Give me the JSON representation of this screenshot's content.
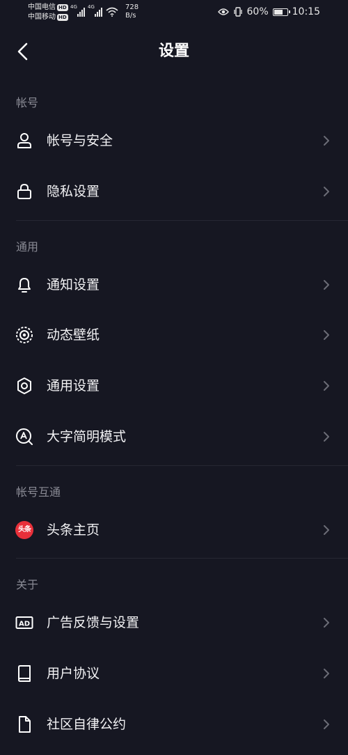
{
  "status_bar": {
    "carrier_1": "中国电信",
    "carrier_2": "中国移动",
    "hd_label": "HD",
    "net_type": "4G",
    "speed_value": "728",
    "speed_unit": "B/s",
    "battery": "60%",
    "time": "10:15"
  },
  "header": {
    "title": "设置",
    "back_icon": "chevron-left-icon"
  },
  "sections": {
    "account": {
      "title": "帐号",
      "items": [
        {
          "label": "帐号与安全",
          "icon": "user-icon"
        },
        {
          "label": "隐私设置",
          "icon": "lock-icon"
        }
      ]
    },
    "general": {
      "title": "通用",
      "items": [
        {
          "label": "通知设置",
          "icon": "bell-icon"
        },
        {
          "label": "动态壁纸",
          "icon": "live-wallpaper-icon"
        },
        {
          "label": "通用设置",
          "icon": "gear-icon"
        },
        {
          "label": "大字简明模式",
          "icon": "large-font-icon"
        }
      ]
    },
    "linked": {
      "title": "帐号互通",
      "items": [
        {
          "label": "头条主页",
          "icon": "toutiao-icon",
          "badge_text": "头条",
          "badge_color": "#e8303a"
        }
      ]
    },
    "about": {
      "title": "关于",
      "items": [
        {
          "label": "广告反馈与设置",
          "icon": "ad-icon",
          "icon_text": "AD"
        },
        {
          "label": "用户协议",
          "icon": "book-icon"
        },
        {
          "label": "社区自律公约",
          "icon": "document-icon"
        }
      ]
    }
  },
  "colors": {
    "background": "#161722",
    "section_title": "#8a8b95",
    "divider": "#262733",
    "chevron": "#6b6c76"
  }
}
